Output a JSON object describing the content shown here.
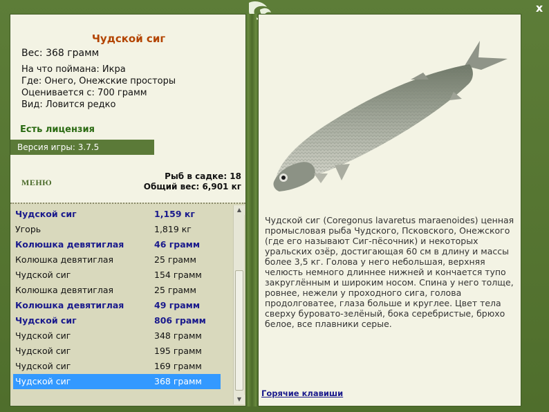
{
  "close_label": "x",
  "fish": {
    "title": "Чудской сиг",
    "weight": "Вес: 368 грамм",
    "bait": "На что поймана: Икра",
    "location": "Где: Онего, Онежские просторы",
    "value": "Оценивается с: 700 грамм",
    "kind": "Вид: Ловится редко"
  },
  "license": "Есть лицензия",
  "version": "Версия игры: 3.7.5",
  "menu_label": "МЕНЮ",
  "keepnet": {
    "count": "Рыб в садке: 18",
    "total": "Общий вес: 6,901 кг"
  },
  "catch_list": [
    {
      "name": "Чудской сиг",
      "value": "1,159 кг",
      "bold": true
    },
    {
      "name": "Угорь",
      "value": "1,819 кг",
      "bold": false
    },
    {
      "name": "Колюшка девятиглая",
      "value": "46 грамм",
      "bold": true
    },
    {
      "name": "Колюшка девятиглая",
      "value": "25 грамм",
      "bold": false
    },
    {
      "name": "Чудской сиг",
      "value": "154 грамм",
      "bold": false
    },
    {
      "name": "Колюшка девятиглая",
      "value": "25 грамм",
      "bold": false
    },
    {
      "name": "Колюшка девятиглая",
      "value": "49 грамм",
      "bold": true
    },
    {
      "name": "Чудской сиг",
      "value": "806 грамм",
      "bold": true
    },
    {
      "name": "Чудской сиг",
      "value": "348 грамм",
      "bold": false
    },
    {
      "name": "Чудской сиг",
      "value": "195 грамм",
      "bold": false
    },
    {
      "name": "Чудской сиг",
      "value": "169 грамм",
      "bold": false
    },
    {
      "name": "Чудской сиг",
      "value": "368 грамм",
      "bold": false,
      "selected": true
    }
  ],
  "description": "Чудской сиг (Coregonus lavaretus maraenoides) ценная промысловая рыба Чудского, Псковского, Онежского (где его называют Сиг-пёсочник) и некоторых уральских озёр, достигающая 60 см в длину и массы более 3,5 кг. Голова у него небольшая, верхняя челюсть немного длиннее нижней и кончается тупо закруглённым и широким носом. Спина у него толще, ровнее, нежели у проходного сига, голова продолговатее, глаза больше и круглее. Цвет тела сверху буровато-зелёный, бока серебристые, брюхо белое, все плавники серые.",
  "hotkeys_label": "Горячие клавиши",
  "colors": {
    "frame": "#5a7a36",
    "panel": "#f3f3e4",
    "title": "#b34400",
    "license": "#2a6a12",
    "bold_row": "#1a1a8c",
    "selected_row": "#3399ff"
  }
}
